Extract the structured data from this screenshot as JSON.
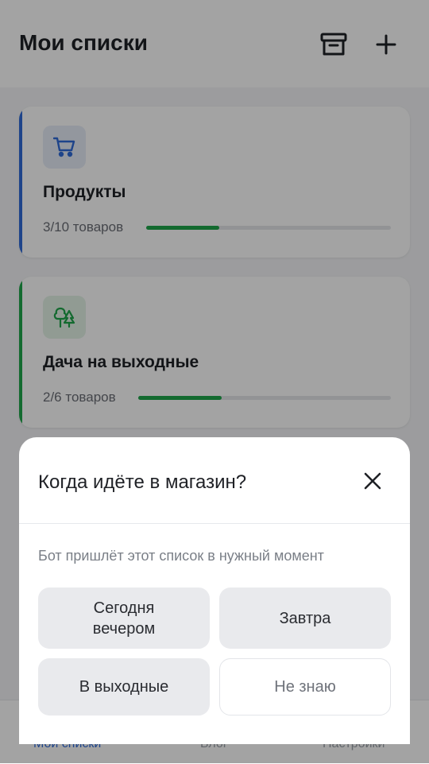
{
  "header": {
    "title": "Мои списки",
    "icons": [
      "archive-icon",
      "plus-icon"
    ]
  },
  "lists": [
    {
      "name": "Продукты",
      "count_text": "3/10 товаров",
      "progress": 0.3,
      "accent": "#2f6bd8",
      "icon": "cart-icon"
    },
    {
      "name": "Дача на выходные",
      "count_text": "2/6 товаров",
      "progress": 0.33,
      "accent": "#1fa64a",
      "icon": "trees-icon"
    }
  ],
  "bottom_nav": [
    {
      "label": "Мои списки",
      "active": true
    },
    {
      "label": "Блог",
      "active": false
    },
    {
      "label": "Настройки",
      "active": false
    }
  ],
  "sheet": {
    "title": "Когда идёте в магазин?",
    "subtitle": "Бот пришлёт этот список в нужный момент",
    "options": [
      {
        "line1": "Сегодня",
        "line2": "вечером"
      },
      {
        "label": "Завтра"
      },
      {
        "label": "В выходные"
      },
      {
        "label": "Не знаю"
      }
    ]
  },
  "colors": {
    "accent_blue": "#2f6bd8",
    "accent_green": "#1fa64a",
    "progress_green": "#1fa64a"
  }
}
